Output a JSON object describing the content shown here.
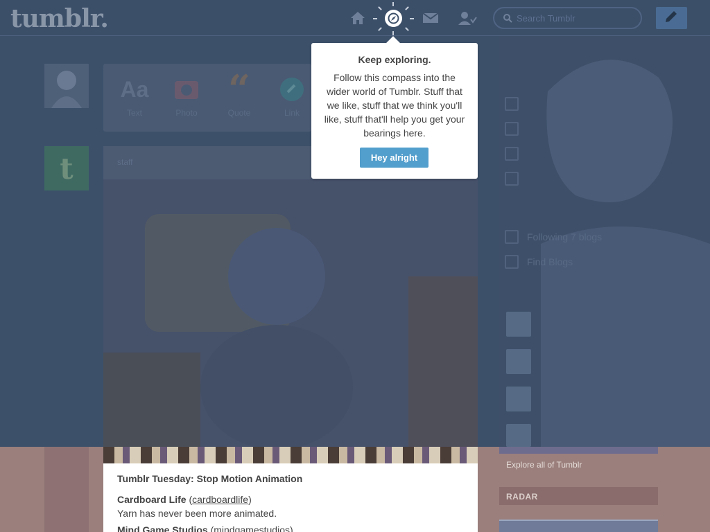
{
  "header": {
    "logo": "tumblr.",
    "search_placeholder": "Search Tumblr",
    "nav_icons": [
      "home-icon",
      "compass-icon",
      "mail-icon",
      "account-icon"
    ],
    "compose_icon": "pencil-icon"
  },
  "post_bar": {
    "items": [
      {
        "label": "Text",
        "icon": "text-icon"
      },
      {
        "label": "Photo",
        "icon": "photo-icon"
      },
      {
        "label": "Quote",
        "icon": "quote-icon"
      },
      {
        "label": "Link",
        "icon": "link-icon"
      }
    ]
  },
  "post": {
    "username": "staff",
    "title": "Tumblr Tuesday: Stop Motion Animation",
    "entry1_name": "Cardboard Life",
    "entry1_link": "cardboardlife",
    "entry1_desc": "Yarn has never been more animated.",
    "entry2_name": "Mind Game Studios",
    "entry2_link": "mindgamestudios"
  },
  "sidebar": {
    "following": "Following 7 blogs",
    "find_blogs": "Find Blogs",
    "explore_link": "Explore all of Tumblr",
    "radar_label": "RADAR"
  },
  "popover": {
    "title": "Keep exploring.",
    "body": "Follow this compass into the wider world of Tumblr. Stuff that we like, stuff that we think you'll like, stuff that'll help you get your bearings here.",
    "button": "Hey alright"
  },
  "colors": {
    "accent": "#529ecc",
    "header_bg": "#3c4f69"
  }
}
